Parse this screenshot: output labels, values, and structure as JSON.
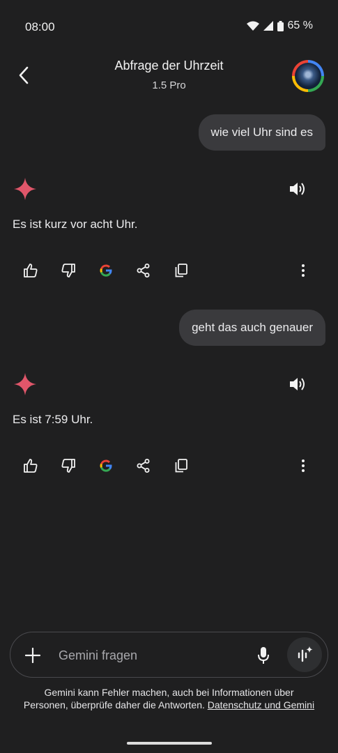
{
  "status": {
    "time": "08:00",
    "battery": "65 %"
  },
  "header": {
    "title": "Abfrage der Uhrzeit",
    "subtitle": "1.5 Pro"
  },
  "conversation": [
    {
      "role": "user",
      "text": "wie viel Uhr sind es"
    },
    {
      "role": "assistant",
      "text": "Es ist kurz vor acht Uhr."
    },
    {
      "role": "user",
      "text": "geht das auch genauer"
    },
    {
      "role": "assistant",
      "text": "Es ist 7:59 Uhr."
    }
  ],
  "input": {
    "placeholder": "Gemini fragen"
  },
  "disclaimer": {
    "text": "Gemini kann Fehler machen, auch bei Informationen über Personen, überprüfe daher die Antworten.",
    "link": "Datenschutz und Gemini"
  },
  "colors": {
    "background": "#1f1f20",
    "bubble": "#3a3a3d",
    "sparkle": "#e0566a"
  },
  "icons": [
    "back-arrow-icon",
    "wifi-icon",
    "signal-icon",
    "battery-icon",
    "sparkle-icon",
    "speaker-icon",
    "thumbs-up-icon",
    "thumbs-down-icon",
    "google-icon",
    "share-icon",
    "copy-icon",
    "more-vert-icon",
    "plus-icon",
    "mic-icon",
    "live-icon"
  ]
}
